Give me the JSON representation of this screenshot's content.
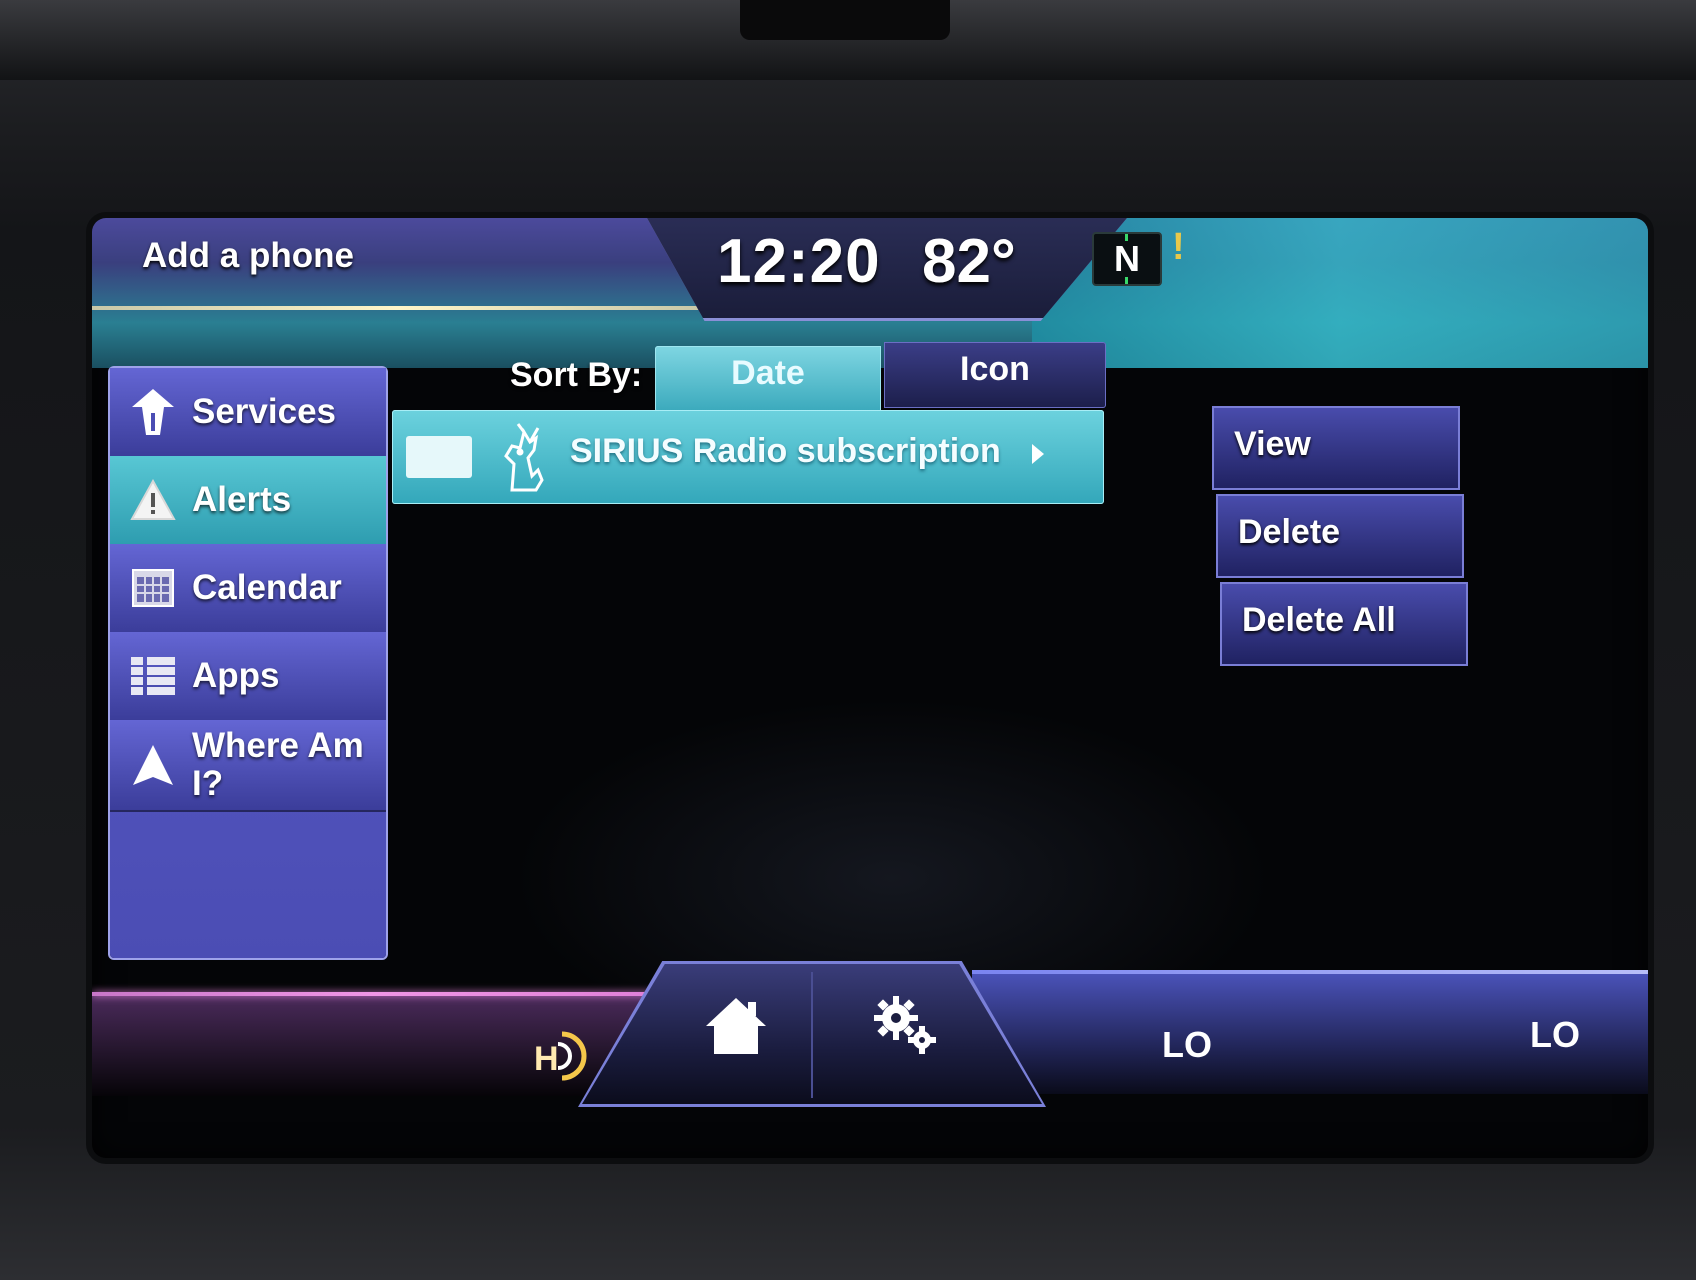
{
  "status": {
    "phone_label": "Add a phone",
    "time": "12:20",
    "temperature": "82°",
    "compass": "N",
    "warning": "!"
  },
  "sidebar": {
    "items": [
      {
        "label": "Services",
        "icon": "road-icon",
        "active": false
      },
      {
        "label": "Alerts",
        "icon": "warning-triangle-icon",
        "active": true
      },
      {
        "label": "Calendar",
        "icon": "calendar-icon",
        "active": false
      },
      {
        "label": "Apps",
        "icon": "apps-list-icon",
        "active": false
      },
      {
        "label": "Where Am I?",
        "icon": "navigation-arrow-icon",
        "active": false
      }
    ]
  },
  "sort": {
    "label": "Sort By:",
    "options": [
      "Date",
      "Icon"
    ],
    "selected": "Date"
  },
  "alerts": [
    {
      "text": "SIRIUS Radio subscription",
      "icon": "sirius-dog-icon"
    }
  ],
  "actions": {
    "view": "View",
    "delete": "Delete",
    "delete_all": "Delete All"
  },
  "bottom": {
    "hd_icon": "hd-radio-icon",
    "home_icon": "home-icon",
    "settings_icon": "gear-icon",
    "climate_left": "LO",
    "climate_right": "LO"
  },
  "colors": {
    "accent_teal": "#3aa9bc",
    "accent_purple": "#4b4db4",
    "accent_pink": "#e080d8"
  }
}
